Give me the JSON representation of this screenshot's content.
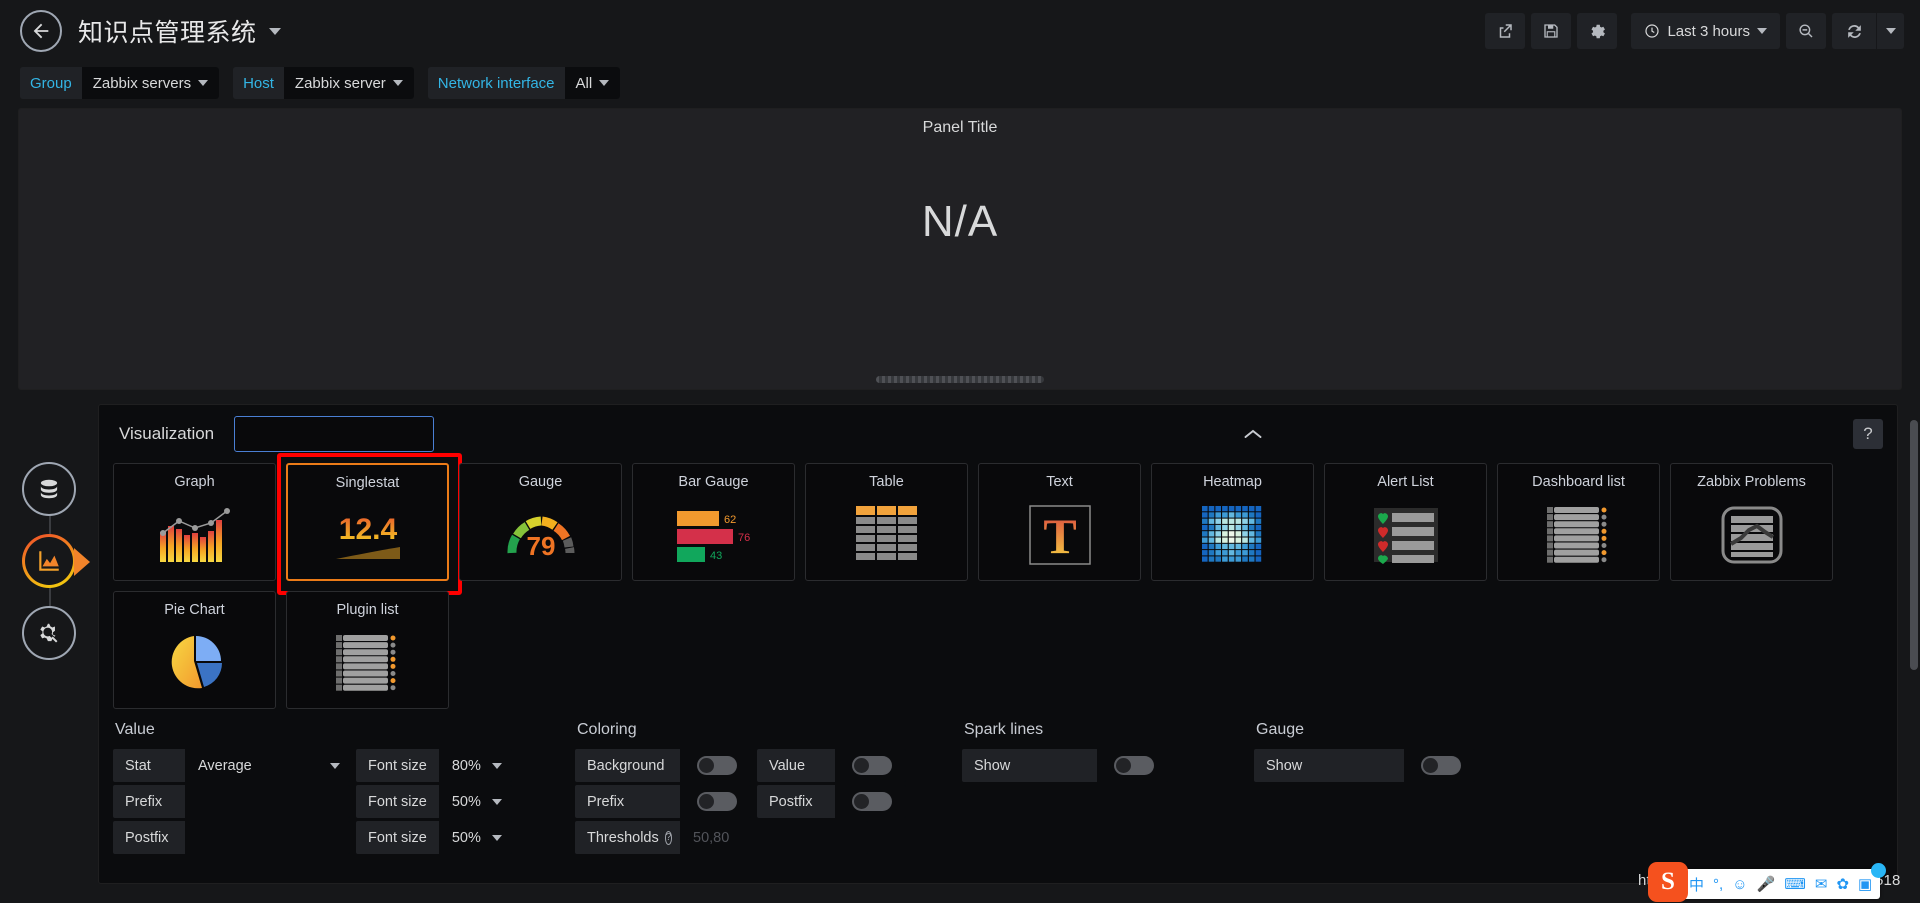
{
  "topnav": {
    "back_icon": "arrow-left-icon",
    "dashboard_title": "知识点管理系统",
    "title_caret_icon": "chevron-down-icon",
    "buttons": [
      {
        "name": "share-dashboard-button",
        "icon": "share-icon"
      },
      {
        "name": "save-dashboard-button",
        "icon": "save-icon"
      },
      {
        "name": "dashboard-settings-button",
        "icon": "gear-icon"
      }
    ],
    "time_picker": {
      "icon": "clock-icon",
      "label": "Last 3 hours",
      "caret": "chevron-down-icon"
    },
    "zoom_out_button": {
      "name": "zoom-out-button",
      "icon": "search-minus-icon"
    },
    "refresh_button": {
      "name": "refresh-button",
      "icon": "refresh-icon"
    },
    "refresh_interval_caret": "chevron-down-icon"
  },
  "variables": [
    {
      "label": "Group",
      "value": "Zabbix servers"
    },
    {
      "label": "Host",
      "value": "Zabbix server"
    },
    {
      "label": "Network interface",
      "value": "All"
    }
  ],
  "preview": {
    "panel_title": "Panel Title",
    "value": "N/A"
  },
  "rail": [
    {
      "name": "queries-tab",
      "icon": "database-icon",
      "active": false
    },
    {
      "name": "visualization-tab",
      "icon": "area-chart-icon",
      "active": true
    },
    {
      "name": "general-tab",
      "icon": "gear-wrench-icon",
      "active": false
    }
  ],
  "editor": {
    "visualization_label": "Visualization",
    "search_placeholder": "",
    "search_value": "",
    "search_icon": "search-icon",
    "collapse_icon": "chevron-up-icon",
    "help_label": "?",
    "selected_type": "Singlestat",
    "types": [
      {
        "name": "Graph",
        "icon": "graph-icon"
      },
      {
        "name": "Singlestat",
        "icon": "singlestat-icon",
        "sample_value": "12.4"
      },
      {
        "name": "Gauge",
        "icon": "gauge-icon",
        "sample_value": "79"
      },
      {
        "name": "Bar Gauge",
        "icon": "bar-gauge-icon",
        "bars": [
          {
            "value": "62",
            "color": "#f2992e"
          },
          {
            "value": "76",
            "color": "#d4304a"
          },
          {
            "value": "43",
            "color": "#11a75c"
          }
        ]
      },
      {
        "name": "Table",
        "icon": "table-icon"
      },
      {
        "name": "Text",
        "icon": "text-icon",
        "glyph": "T"
      },
      {
        "name": "Heatmap",
        "icon": "heatmap-icon"
      },
      {
        "name": "Alert List",
        "icon": "alert-list-icon"
      },
      {
        "name": "Dashboard list",
        "icon": "dashboard-list-icon"
      },
      {
        "name": "Zabbix Problems",
        "icon": "zabbix-problems-icon"
      },
      {
        "name": "Pie Chart",
        "icon": "pie-chart-icon"
      },
      {
        "name": "Plugin list",
        "icon": "plugin-list-icon"
      }
    ]
  },
  "options": {
    "value": {
      "title": "Value",
      "rows": [
        {
          "label": "Stat",
          "control": "select",
          "value": "Average",
          "label2": "Font size",
          "value2": "80%"
        },
        {
          "label": "Prefix",
          "control": "input",
          "value": "",
          "label2": "Font size",
          "value2": "50%"
        },
        {
          "label": "Postfix",
          "control": "input",
          "value": "",
          "label2": "Font size",
          "value2": "50%"
        }
      ]
    },
    "coloring": {
      "title": "Coloring",
      "toggles": [
        {
          "label": "Background",
          "on": false
        },
        {
          "label": "Value",
          "on": false
        },
        {
          "label": "Prefix",
          "on": false
        },
        {
          "label": "Postfix",
          "on": false
        }
      ],
      "thresholds": {
        "label": "Thresholds",
        "help_icon": "question-circle-icon",
        "placeholder": "50,80",
        "value": ""
      }
    },
    "sparklines": {
      "title": "Spark lines",
      "toggle": {
        "label": "Show",
        "on": false
      }
    },
    "gauge": {
      "title": "Gauge",
      "toggle": {
        "label": "Show",
        "on": false
      }
    }
  },
  "ime": {
    "url_text": "https://blog.csdn.net/weixin_44453518",
    "logo": "S",
    "items": [
      "中",
      "°,",
      "☺",
      "🎤",
      "⌨",
      "✉",
      "✿",
      "▣"
    ]
  },
  "colors": {
    "accent_orange": "#eb7b18",
    "highlight_red": "#ff0000",
    "link_blue": "#33b5e5",
    "panel_bg": "#212124",
    "page_bg": "#161719"
  }
}
